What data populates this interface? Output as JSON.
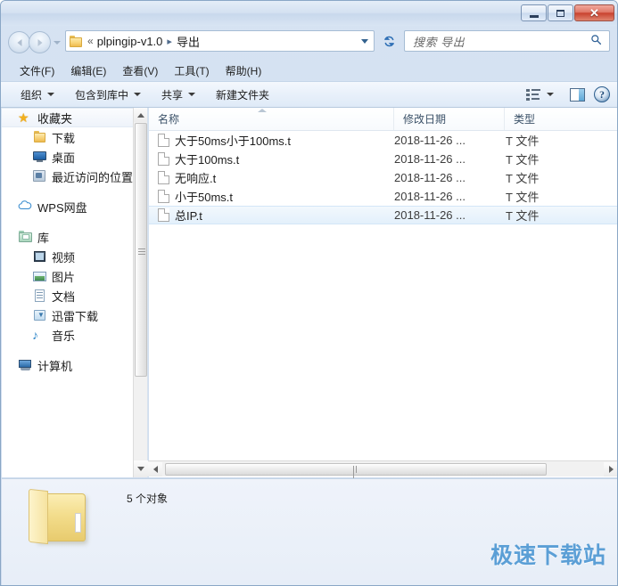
{
  "window": {
    "minimize_label": "最小化",
    "maximize_label": "最大化",
    "close_label": "✕"
  },
  "address": {
    "folder_icon": "folder-icon",
    "overflow": "«",
    "crumb1": "plpingip-v1.0",
    "separator": "▸",
    "crumb2": "导出",
    "refresh_icon": "↻"
  },
  "search": {
    "placeholder": "搜索 导出",
    "icon": "search-icon"
  },
  "menubar": {
    "items": [
      {
        "label": "文件(F)"
      },
      {
        "label": "编辑(E)"
      },
      {
        "label": "查看(V)"
      },
      {
        "label": "工具(T)"
      },
      {
        "label": "帮助(H)"
      }
    ]
  },
  "toolbar": {
    "organize": "组织",
    "include_in_library": "包含到库中",
    "share": "共享",
    "new_folder": "新建文件夹",
    "views_icon": "view-options-icon",
    "preview_pane_icon": "preview-pane-icon",
    "help_icon": "?"
  },
  "sidebar": {
    "groups": [
      {
        "header": {
          "label": "收藏夹",
          "icon": "star-icon",
          "selected": true
        },
        "items": [
          {
            "label": "下载",
            "icon": "folder-icon"
          },
          {
            "label": "桌面",
            "icon": "desktop-icon"
          },
          {
            "label": "最近访问的位置",
            "icon": "recent-places-icon"
          }
        ]
      },
      {
        "header": {
          "label": "WPS网盘",
          "icon": "cloud-icon",
          "selected": false
        },
        "items": []
      },
      {
        "header": {
          "label": "库",
          "icon": "library-icon",
          "selected": false
        },
        "items": [
          {
            "label": "视频",
            "icon": "video-icon"
          },
          {
            "label": "图片",
            "icon": "picture-icon"
          },
          {
            "label": "文档",
            "icon": "document-icon"
          },
          {
            "label": "迅雷下载",
            "icon": "thunder-download-icon"
          },
          {
            "label": "音乐",
            "icon": "music-icon"
          }
        ]
      },
      {
        "header": {
          "label": "计算机",
          "icon": "computer-icon",
          "selected": false
        },
        "items": []
      }
    ]
  },
  "filelist": {
    "columns": {
      "name": "名称",
      "date_modified": "修改日期",
      "type": "类型"
    },
    "rows": [
      {
        "name": "大于50ms小于100ms.t",
        "date": "2018-11-26 ...",
        "type": "T 文件",
        "hover": false
      },
      {
        "name": "大于100ms.t",
        "date": "2018-11-26 ...",
        "type": "T 文件",
        "hover": false
      },
      {
        "name": "无响应.t",
        "date": "2018-11-26 ...",
        "type": "T 文件",
        "hover": false
      },
      {
        "name": "小于50ms.t",
        "date": "2018-11-26 ...",
        "type": "T 文件",
        "hover": false
      },
      {
        "name": "总IP.t",
        "date": "2018-11-26 ...",
        "type": "T 文件",
        "hover": true
      }
    ]
  },
  "statusbar": {
    "folder_icon": "folder-large-icon",
    "item_count": "5 个对象"
  },
  "watermark": {
    "text": "极速下载站",
    "color": "#5b9fd6"
  }
}
